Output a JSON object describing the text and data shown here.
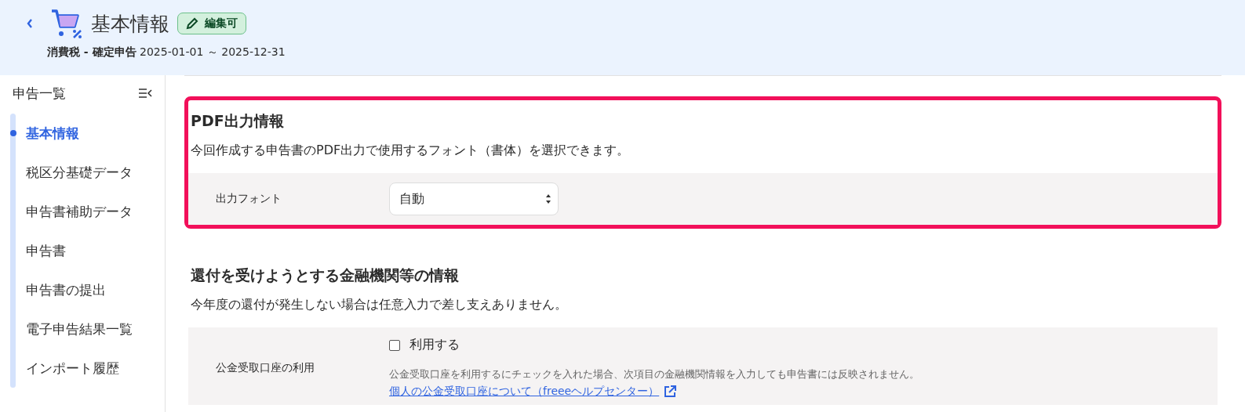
{
  "header": {
    "title": "基本情報",
    "badge": "編集可",
    "subtitle_bold": "消費税 - 確定申告",
    "period": "2025-01-01 ～ 2025-12-31"
  },
  "sidebar": {
    "title": "申告一覧",
    "items": [
      {
        "label": "基本情報",
        "selected": true
      },
      {
        "label": "税区分基礎データ",
        "selected": false
      },
      {
        "label": "申告書補助データ",
        "selected": false
      },
      {
        "label": "申告書",
        "selected": false
      },
      {
        "label": "申告書の提出",
        "selected": false
      },
      {
        "label": "電子申告結果一覧",
        "selected": false
      },
      {
        "label": "インポート履歴",
        "selected": false
      }
    ]
  },
  "sections": [
    {
      "title": "PDF出力情報",
      "description": "今回作成する申告書のPDF出力で使用するフォント（書体）を選択できます。",
      "highlighted": true,
      "rows": [
        {
          "kind": "select",
          "label": "出力フォント",
          "value": "自動"
        }
      ]
    },
    {
      "title": "還付を受けようとする金融機関等の情報",
      "description": "今年度の還付が発生しない場合は任意入力で差し支えありません。",
      "highlighted": false,
      "rows": [
        {
          "kind": "checkbox",
          "label": "公金受取口座の利用",
          "option": "利用する",
          "checked": false,
          "note": "公金受取口座を利用するにチェックを入れた場合、次項目の金融機関情報を入力しても申告書には反映されません。",
          "link": "個人の公金受取口座について（freeeヘルプセンター）"
        }
      ]
    }
  ]
}
